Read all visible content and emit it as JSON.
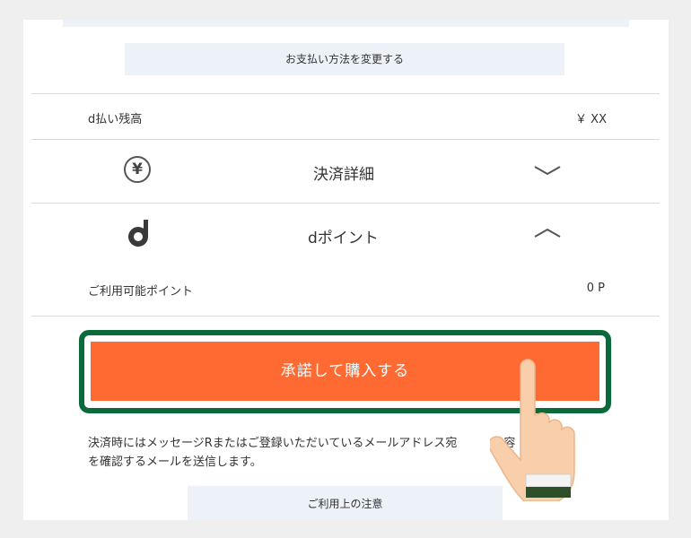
{
  "payment": {
    "change_method_label": "お支払い方法を変更する"
  },
  "balance": {
    "label": "d払い残高",
    "value": "￥ XX"
  },
  "settlement_details": {
    "title": "決済詳細",
    "icon": "yen-circle-icon",
    "state": "collapsed"
  },
  "dpoint": {
    "title": "dポイント",
    "icon": "d-logo-icon",
    "state": "expanded",
    "available_label": "ご利用可能ポイント",
    "available_value": "0 P"
  },
  "purchase": {
    "button_label": "承諾して購入する",
    "highlight_color": "#0b6a3c",
    "button_color": "#ff6a33"
  },
  "notice": {
    "line1": "決済時にはメッセージRまたはご登録いただいているメールアドレス宛　　　内容",
    "line2": "を確認するメールを送信します。"
  },
  "notes": {
    "button_label": "ご利用上の注意"
  }
}
